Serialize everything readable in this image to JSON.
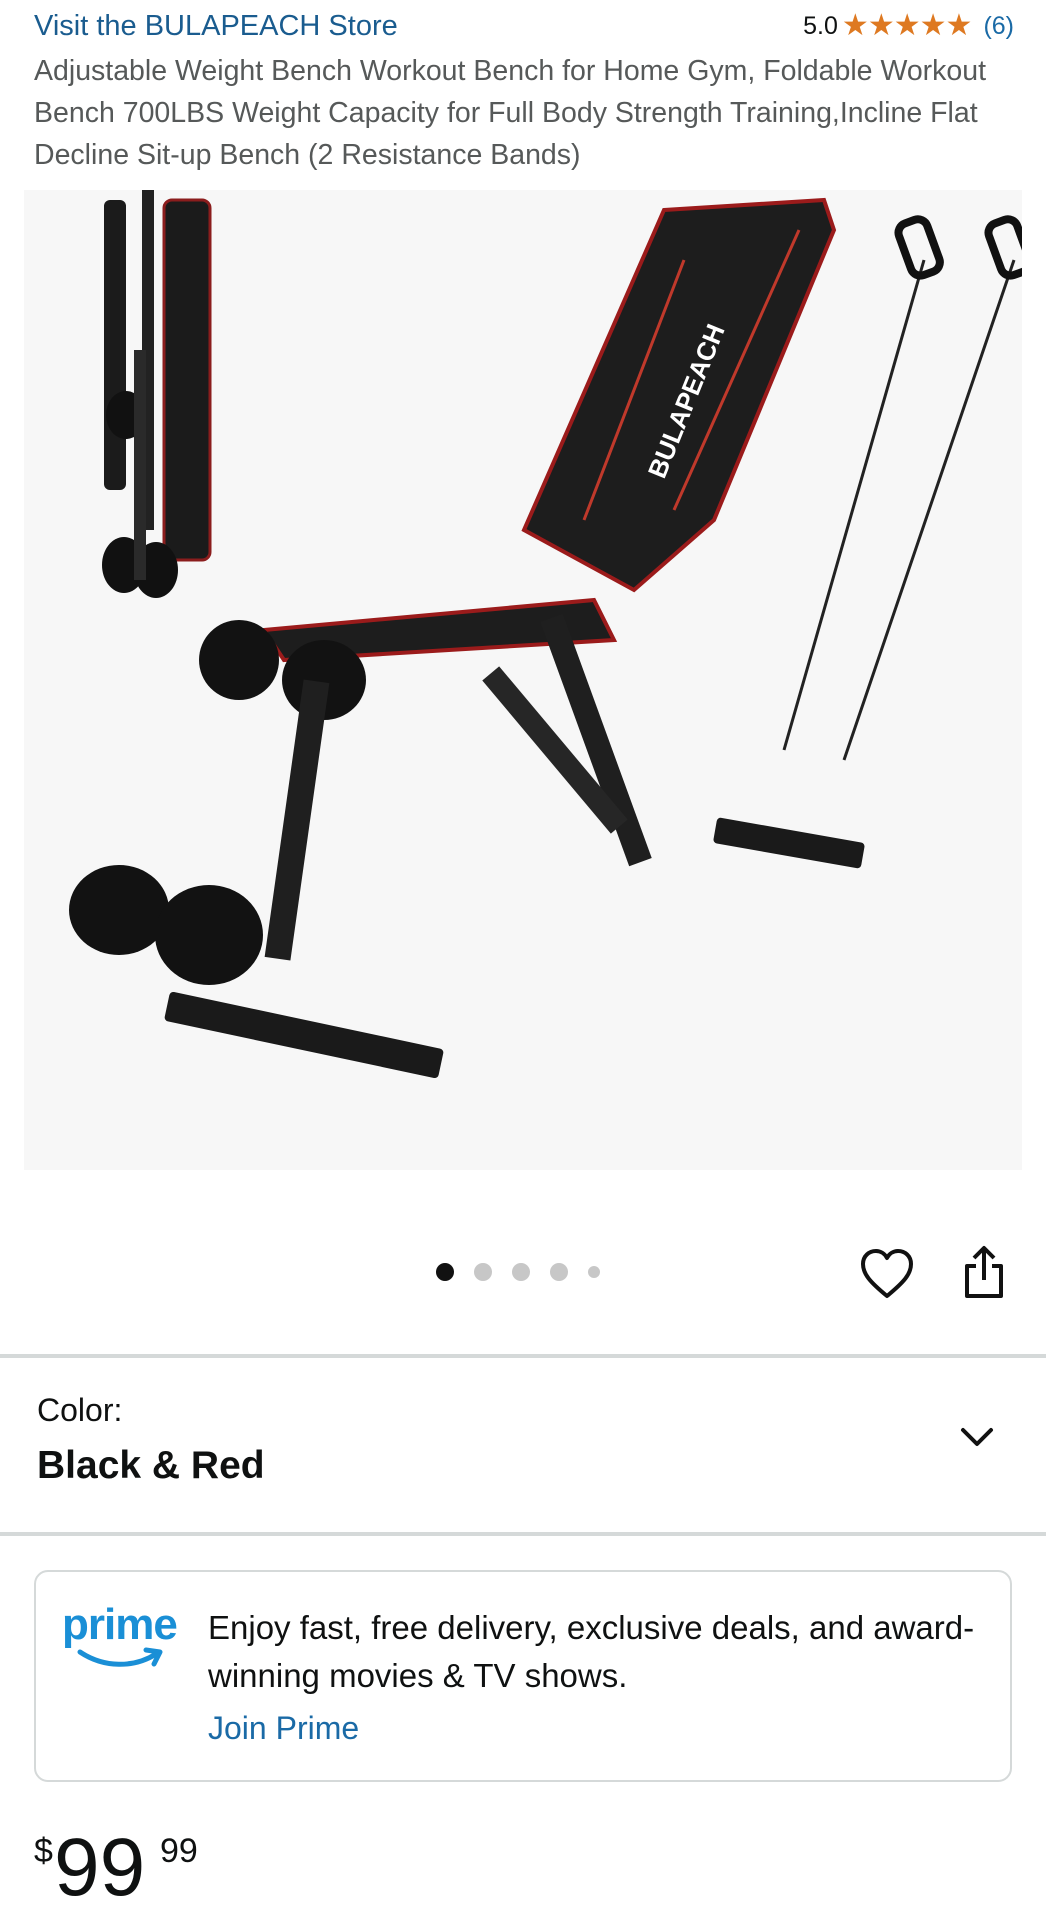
{
  "store": {
    "link_text": "Visit the BULAPEACH Store"
  },
  "rating": {
    "value": "5.0",
    "stars": 5,
    "count": "(6)",
    "star_color": "#de7921"
  },
  "product": {
    "title": "Adjustable Weight Bench Workout Bench for Home Gym, Foldable Workout Bench 700LBS Weight Capacity for Full Body Strength Training,Incline Flat Decline Sit-up Bench (2 Resistance Bands)",
    "image_brand_text": "BULAPEACH"
  },
  "carousel": {
    "total_dots": 5,
    "active_index": 0
  },
  "actions": {
    "wishlist_icon": "heart-icon",
    "share_icon": "share-icon"
  },
  "color": {
    "label": "Color:",
    "value": "Black & Red",
    "dropdown_icon": "chevron-down-icon"
  },
  "prime": {
    "logo_text": "prime",
    "description": "Enjoy fast, free delivery, exclusive deals, and award-winning movies & TV shows.",
    "cta": "Join Prime",
    "brand_color": "#1a8fd6"
  },
  "price": {
    "symbol": "$",
    "whole": "99",
    "fraction": "99"
  }
}
